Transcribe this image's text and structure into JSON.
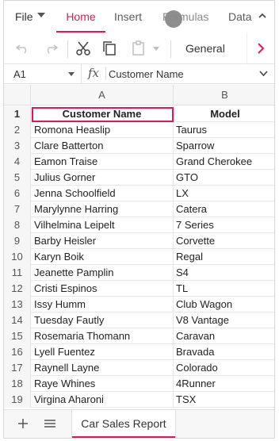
{
  "ribbon": {
    "tabs": [
      {
        "label": "File"
      },
      {
        "label": "Home"
      },
      {
        "label": "Insert"
      },
      {
        "label": "Formulas"
      },
      {
        "label": "Data"
      }
    ],
    "active_tab": "Home"
  },
  "toolbar": {
    "number_format": "General",
    "icons": [
      "undo-icon",
      "redo-icon",
      "cut-icon",
      "copy-icon",
      "paste-icon",
      "chevron-right-icon"
    ]
  },
  "formula_bar": {
    "name_box": "A1",
    "fx_label": "fx",
    "value": "Customer Name"
  },
  "grid": {
    "columns": [
      "A",
      "B"
    ],
    "rows": [
      {
        "num": "1",
        "a": "Customer Name",
        "b": "Model"
      },
      {
        "num": "2",
        "a": "Romona Heaslip",
        "b": "Taurus"
      },
      {
        "num": "3",
        "a": "Clare Batterton",
        "b": "Sparrow"
      },
      {
        "num": "4",
        "a": "Eamon Traise",
        "b": "Grand Cherokee"
      },
      {
        "num": "5",
        "a": "Julius Gorner",
        "b": "GTO"
      },
      {
        "num": "6",
        "a": "Jenna Schoolfield",
        "b": "LX"
      },
      {
        "num": "7",
        "a": "Marylynne Harring",
        "b": "Catera"
      },
      {
        "num": "8",
        "a": "Vilhelmina Leipelt",
        "b": "7 Series"
      },
      {
        "num": "9",
        "a": "Barby Heisler",
        "b": "Corvette"
      },
      {
        "num": "10",
        "a": "Karyn Boik",
        "b": "Regal"
      },
      {
        "num": "11",
        "a": "Jeanette Pamplin",
        "b": "S4"
      },
      {
        "num": "12",
        "a": "Cristi Espinos",
        "b": "TL"
      },
      {
        "num": "13",
        "a": "Issy Humm",
        "b": "Club Wagon"
      },
      {
        "num": "14",
        "a": "Tuesday Fautly",
        "b": "V8 Vantage"
      },
      {
        "num": "15",
        "a": "Rosemaria Thomann",
        "b": "Caravan"
      },
      {
        "num": "16",
        "a": "Lyell Fuentez",
        "b": "Bravada"
      },
      {
        "num": "17",
        "a": "Raynell Layne",
        "b": "Colorado"
      },
      {
        "num": "18",
        "a": "Raye Whines",
        "b": "4Runner"
      },
      {
        "num": "19",
        "a": "Virgina Aharoni",
        "b": "TSX"
      }
    ]
  },
  "sheets": {
    "active": "Car Sales Report"
  },
  "colors": {
    "accent": "#e3165b"
  }
}
